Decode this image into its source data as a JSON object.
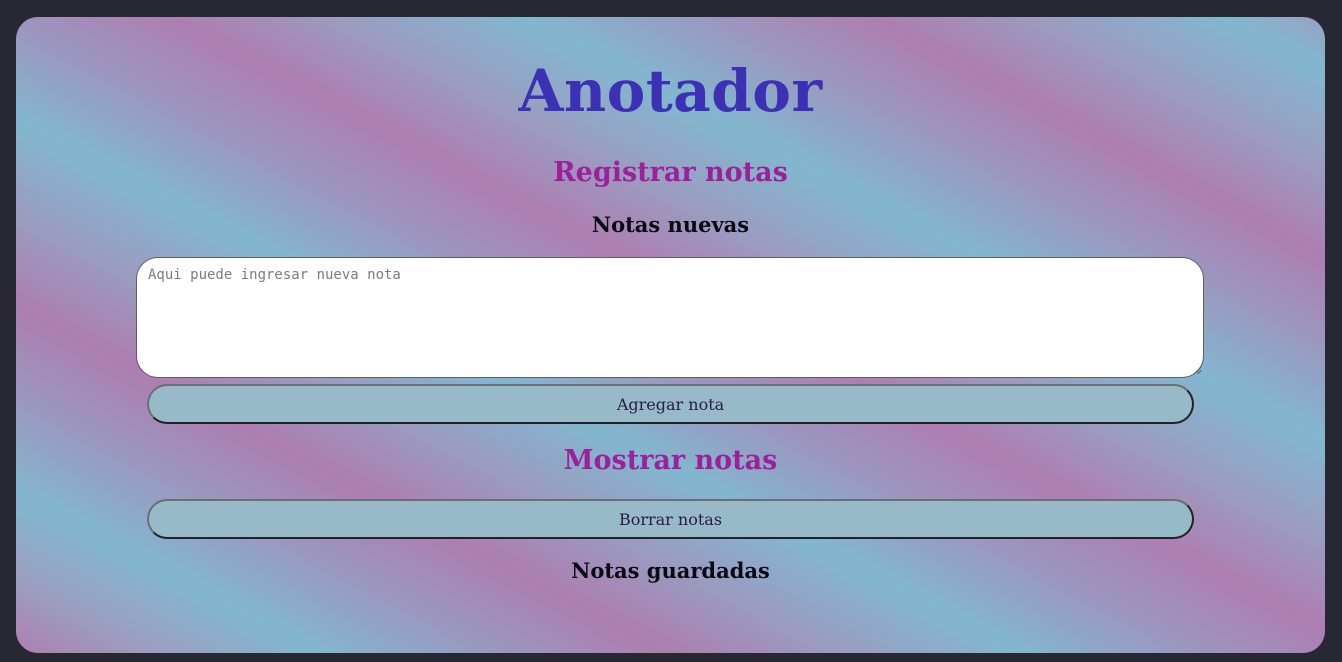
{
  "app": {
    "title": "Anotador"
  },
  "register": {
    "heading": "Registrar notas",
    "subheading": "Notas nuevas",
    "input_placeholder": "Aqui puede ingresar nueva nota",
    "input_value": "",
    "add_button_label": "Agregar nota"
  },
  "show": {
    "heading": "Mostrar notas",
    "clear_button_label": "Borrar notas",
    "saved_heading": "Notas guardadas"
  },
  "colors": {
    "page_background": "#272834",
    "title": "#3c30b4",
    "section_heading": "#9b219b",
    "button_fill": "#97b9c8",
    "button_text": "#241c4a",
    "gradient_pink": "#ae7fb1",
    "gradient_blue": "#82b7cf"
  }
}
